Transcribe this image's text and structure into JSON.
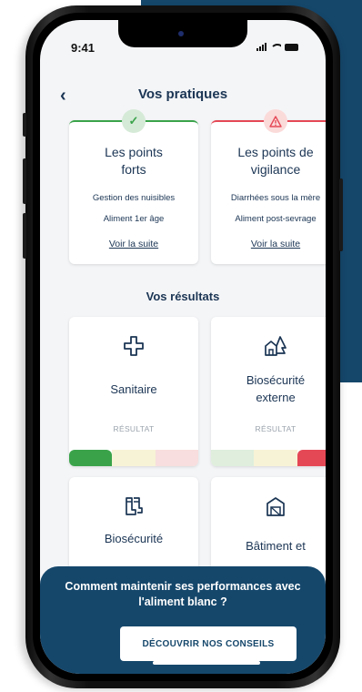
{
  "status_bar": {
    "time": "9:41"
  },
  "header": {
    "title": "Vos pratiques",
    "back_icon": "chevron-left-icon"
  },
  "summary": {
    "strengths": {
      "title_line1": "Les points",
      "title_line2": "forts",
      "items": [
        "Gestion des nuisibles",
        "Aliment 1er âge"
      ],
      "link": "Voir la suite",
      "icon": "check-icon",
      "color": "#3aa34a"
    },
    "vigilance": {
      "title_line1": "Les points de",
      "title_line2": "vigilance",
      "items": [
        "Diarrhées sous la mère",
        "Aliment post-sevrage"
      ],
      "link": "Voir la suite",
      "icon": "warning-icon",
      "color": "#e54855"
    }
  },
  "results": {
    "section_title": "Vos résultats",
    "cards": [
      {
        "label_line1": "Sanitaire",
        "label_line2": "",
        "result_label": "RÉSULTAT",
        "icon": "medical-cross-icon",
        "level": "good"
      },
      {
        "label_line1": "Biosécurité",
        "label_line2": "externe",
        "result_label": "RÉSULTAT",
        "icon": "farm-building-icon",
        "level": "bad"
      },
      {
        "label_line1": "Biosécurité",
        "label_line2": "",
        "result_label": "",
        "icon": "boots-icon"
      },
      {
        "label_line1": "Bâtiment et",
        "label_line2": "",
        "result_label": "",
        "icon": "barn-icon"
      }
    ]
  },
  "banner": {
    "text_line1": "Comment maintenir ses performances avec",
    "text_line2": "l'aliment blanc ?",
    "button": "DÉCOUVRIR NOS CONSEILS"
  },
  "colors": {
    "primary": "#15476b",
    "text": "#1b3554",
    "good": "#3aa34a",
    "bad": "#e54855",
    "neutral_yellow": "#f7f3d6"
  }
}
